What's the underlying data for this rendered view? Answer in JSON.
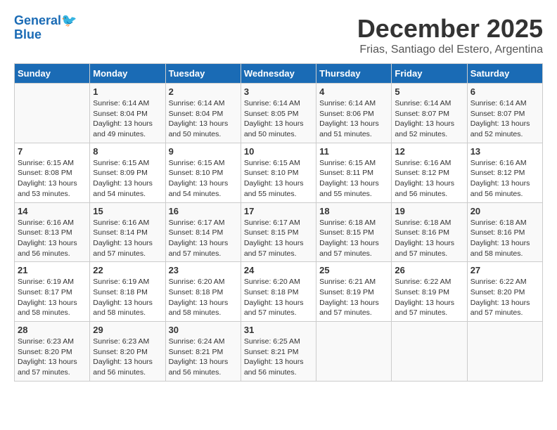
{
  "logo": {
    "line1": "General",
    "line2": "Blue"
  },
  "title": "December 2025",
  "location": "Frias, Santiago del Estero, Argentina",
  "weekdays": [
    "Sunday",
    "Monday",
    "Tuesday",
    "Wednesday",
    "Thursday",
    "Friday",
    "Saturday"
  ],
  "weeks": [
    [
      {
        "day": "",
        "sunrise": "",
        "sunset": "",
        "daylight": ""
      },
      {
        "day": "1",
        "sunrise": "Sunrise: 6:14 AM",
        "sunset": "Sunset: 8:04 PM",
        "daylight": "Daylight: 13 hours and 49 minutes."
      },
      {
        "day": "2",
        "sunrise": "Sunrise: 6:14 AM",
        "sunset": "Sunset: 8:04 PM",
        "daylight": "Daylight: 13 hours and 50 minutes."
      },
      {
        "day": "3",
        "sunrise": "Sunrise: 6:14 AM",
        "sunset": "Sunset: 8:05 PM",
        "daylight": "Daylight: 13 hours and 50 minutes."
      },
      {
        "day": "4",
        "sunrise": "Sunrise: 6:14 AM",
        "sunset": "Sunset: 8:06 PM",
        "daylight": "Daylight: 13 hours and 51 minutes."
      },
      {
        "day": "5",
        "sunrise": "Sunrise: 6:14 AM",
        "sunset": "Sunset: 8:07 PM",
        "daylight": "Daylight: 13 hours and 52 minutes."
      },
      {
        "day": "6",
        "sunrise": "Sunrise: 6:14 AM",
        "sunset": "Sunset: 8:07 PM",
        "daylight": "Daylight: 13 hours and 52 minutes."
      }
    ],
    [
      {
        "day": "7",
        "sunrise": "Sunrise: 6:15 AM",
        "sunset": "Sunset: 8:08 PM",
        "daylight": "Daylight: 13 hours and 53 minutes."
      },
      {
        "day": "8",
        "sunrise": "Sunrise: 6:15 AM",
        "sunset": "Sunset: 8:09 PM",
        "daylight": "Daylight: 13 hours and 54 minutes."
      },
      {
        "day": "9",
        "sunrise": "Sunrise: 6:15 AM",
        "sunset": "Sunset: 8:10 PM",
        "daylight": "Daylight: 13 hours and 54 minutes."
      },
      {
        "day": "10",
        "sunrise": "Sunrise: 6:15 AM",
        "sunset": "Sunset: 8:10 PM",
        "daylight": "Daylight: 13 hours and 55 minutes."
      },
      {
        "day": "11",
        "sunrise": "Sunrise: 6:15 AM",
        "sunset": "Sunset: 8:11 PM",
        "daylight": "Daylight: 13 hours and 55 minutes."
      },
      {
        "day": "12",
        "sunrise": "Sunrise: 6:16 AM",
        "sunset": "Sunset: 8:12 PM",
        "daylight": "Daylight: 13 hours and 56 minutes."
      },
      {
        "day": "13",
        "sunrise": "Sunrise: 6:16 AM",
        "sunset": "Sunset: 8:12 PM",
        "daylight": "Daylight: 13 hours and 56 minutes."
      }
    ],
    [
      {
        "day": "14",
        "sunrise": "Sunrise: 6:16 AM",
        "sunset": "Sunset: 8:13 PM",
        "daylight": "Daylight: 13 hours and 56 minutes."
      },
      {
        "day": "15",
        "sunrise": "Sunrise: 6:16 AM",
        "sunset": "Sunset: 8:14 PM",
        "daylight": "Daylight: 13 hours and 57 minutes."
      },
      {
        "day": "16",
        "sunrise": "Sunrise: 6:17 AM",
        "sunset": "Sunset: 8:14 PM",
        "daylight": "Daylight: 13 hours and 57 minutes."
      },
      {
        "day": "17",
        "sunrise": "Sunrise: 6:17 AM",
        "sunset": "Sunset: 8:15 PM",
        "daylight": "Daylight: 13 hours and 57 minutes."
      },
      {
        "day": "18",
        "sunrise": "Sunrise: 6:18 AM",
        "sunset": "Sunset: 8:15 PM",
        "daylight": "Daylight: 13 hours and 57 minutes."
      },
      {
        "day": "19",
        "sunrise": "Sunrise: 6:18 AM",
        "sunset": "Sunset: 8:16 PM",
        "daylight": "Daylight: 13 hours and 57 minutes."
      },
      {
        "day": "20",
        "sunrise": "Sunrise: 6:18 AM",
        "sunset": "Sunset: 8:16 PM",
        "daylight": "Daylight: 13 hours and 58 minutes."
      }
    ],
    [
      {
        "day": "21",
        "sunrise": "Sunrise: 6:19 AM",
        "sunset": "Sunset: 8:17 PM",
        "daylight": "Daylight: 13 hours and 58 minutes."
      },
      {
        "day": "22",
        "sunrise": "Sunrise: 6:19 AM",
        "sunset": "Sunset: 8:18 PM",
        "daylight": "Daylight: 13 hours and 58 minutes."
      },
      {
        "day": "23",
        "sunrise": "Sunrise: 6:20 AM",
        "sunset": "Sunset: 8:18 PM",
        "daylight": "Daylight: 13 hours and 58 minutes."
      },
      {
        "day": "24",
        "sunrise": "Sunrise: 6:20 AM",
        "sunset": "Sunset: 8:18 PM",
        "daylight": "Daylight: 13 hours and 57 minutes."
      },
      {
        "day": "25",
        "sunrise": "Sunrise: 6:21 AM",
        "sunset": "Sunset: 8:19 PM",
        "daylight": "Daylight: 13 hours and 57 minutes."
      },
      {
        "day": "26",
        "sunrise": "Sunrise: 6:22 AM",
        "sunset": "Sunset: 8:19 PM",
        "daylight": "Daylight: 13 hours and 57 minutes."
      },
      {
        "day": "27",
        "sunrise": "Sunrise: 6:22 AM",
        "sunset": "Sunset: 8:20 PM",
        "daylight": "Daylight: 13 hours and 57 minutes."
      }
    ],
    [
      {
        "day": "28",
        "sunrise": "Sunrise: 6:23 AM",
        "sunset": "Sunset: 8:20 PM",
        "daylight": "Daylight: 13 hours and 57 minutes."
      },
      {
        "day": "29",
        "sunrise": "Sunrise: 6:23 AM",
        "sunset": "Sunset: 8:20 PM",
        "daylight": "Daylight: 13 hours and 56 minutes."
      },
      {
        "day": "30",
        "sunrise": "Sunrise: 6:24 AM",
        "sunset": "Sunset: 8:21 PM",
        "daylight": "Daylight: 13 hours and 56 minutes."
      },
      {
        "day": "31",
        "sunrise": "Sunrise: 6:25 AM",
        "sunset": "Sunset: 8:21 PM",
        "daylight": "Daylight: 13 hours and 56 minutes."
      },
      {
        "day": "",
        "sunrise": "",
        "sunset": "",
        "daylight": ""
      },
      {
        "day": "",
        "sunrise": "",
        "sunset": "",
        "daylight": ""
      },
      {
        "day": "",
        "sunrise": "",
        "sunset": "",
        "daylight": ""
      }
    ]
  ]
}
